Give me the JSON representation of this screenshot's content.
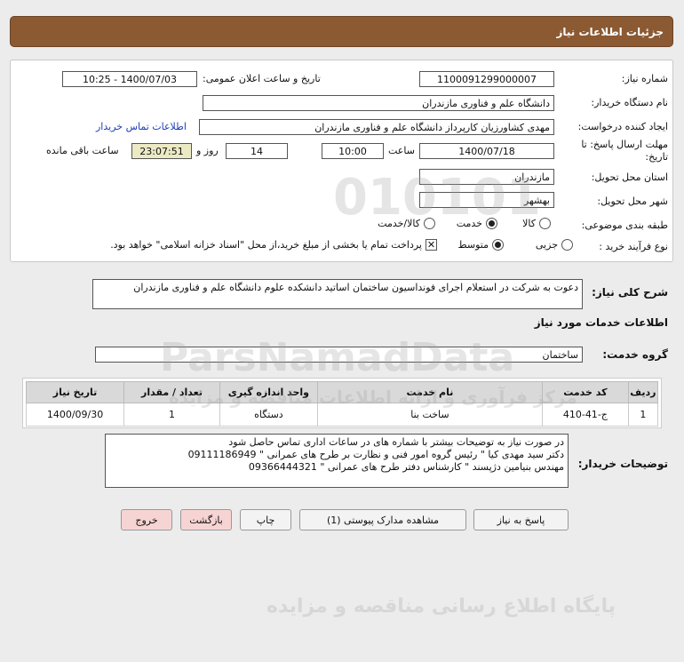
{
  "header": {
    "title": "جزئیات اطلاعات نیاز"
  },
  "form": {
    "need_number_label": "شماره نیاز:",
    "need_number": "1100091299000007",
    "announce_label": "تاریخ و ساعت اعلان عمومی:",
    "announce_value": "1400/07/03 - 10:25",
    "buyer_org_label": "نام دستگاه خریدار:",
    "buyer_org": "دانشگاه علم و فناوری مازندران",
    "creator_label": "ایجاد کننده درخواست:",
    "creator": "مهدی  کشاورزیان کارپرداز دانشگاه علم و فناوری مازندران",
    "contact_link": "اطلاعات تماس خریدار",
    "deadline_label": "مهلت ارسال پاسخ: تا تاریخ:",
    "deadline_date": "1400/07/18",
    "time_label": "ساعت",
    "deadline_time": "10:00",
    "days_value": "14",
    "days_label": "روز و",
    "remaining_time": "23:07:51",
    "remaining_label": "ساعت باقی مانده",
    "province_label": "استان محل تحویل:",
    "province": "مازندران",
    "city_label": "شهر محل تحویل:",
    "city": "بهشهر",
    "category_label": "طبقه بندی موضوعی:",
    "category_options": [
      "کالا",
      "خدمت",
      "کالا/خدمت"
    ],
    "category_selected": "خدمت",
    "process_label": "نوع فرآیند خرید :",
    "process_options": [
      "جزیی",
      "متوسط"
    ],
    "process_selected": "متوسط",
    "payment_note": "پرداخت تمام یا بخشی از مبلغ خرید،از محل \"اسناد خزانه اسلامی\" خواهد بود.",
    "payment_checked": true
  },
  "description": {
    "label": "شرح کلی نیاز:",
    "text": "دعوت به شرکت در استعلام اجرای فونداسیون ساختمان اساتید دانشکده علوم دانشگاه علم و فناوری مازندران"
  },
  "services": {
    "section_title": "اطلاعات خدمات مورد نیاز",
    "group_label": "گروه خدمت:",
    "group_value": "ساختمان",
    "columns": [
      "ردیف",
      "کد خدمت",
      "نام خدمت",
      "واحد اندازه گیری",
      "تعداد / مقدار",
      "تاریخ نیاز"
    ],
    "rows": [
      [
        "1",
        "ج-41-410",
        "ساخت بنا",
        "دستگاه",
        "1",
        "1400/09/30"
      ]
    ]
  },
  "buyer_notes": {
    "label": "توضیحات خریدار:",
    "lines": [
      "در صورت نیاز به توضیحات بیشتر با شماره های در ساعات اداری تماس حاصل شود",
      "دکتر سید مهدی کیا \" رئیس گروه امور فنی و نظارت بر طرح های عمرانی \" 09111186949",
      "مهندس بنیامین دژپسند \" کارشناس دفتر طرح های عمرانی \" 09366444321"
    ]
  },
  "buttons": {
    "reply": "پاسخ به نیاز",
    "attachments": "مشاهده مدارک پیوستی (1)",
    "print": "چاپ",
    "back": "بازگشت",
    "exit": "خروج"
  },
  "watermark": {
    "digits": "010101",
    "brand": "ParsNamadData",
    "tagline_1": "مرکز فرآوری و ارائه اطلاعات مناقصه و مزایده",
    "tagline_2": "پایگاه اطلاع رسانی مناقصه و مزایده"
  }
}
